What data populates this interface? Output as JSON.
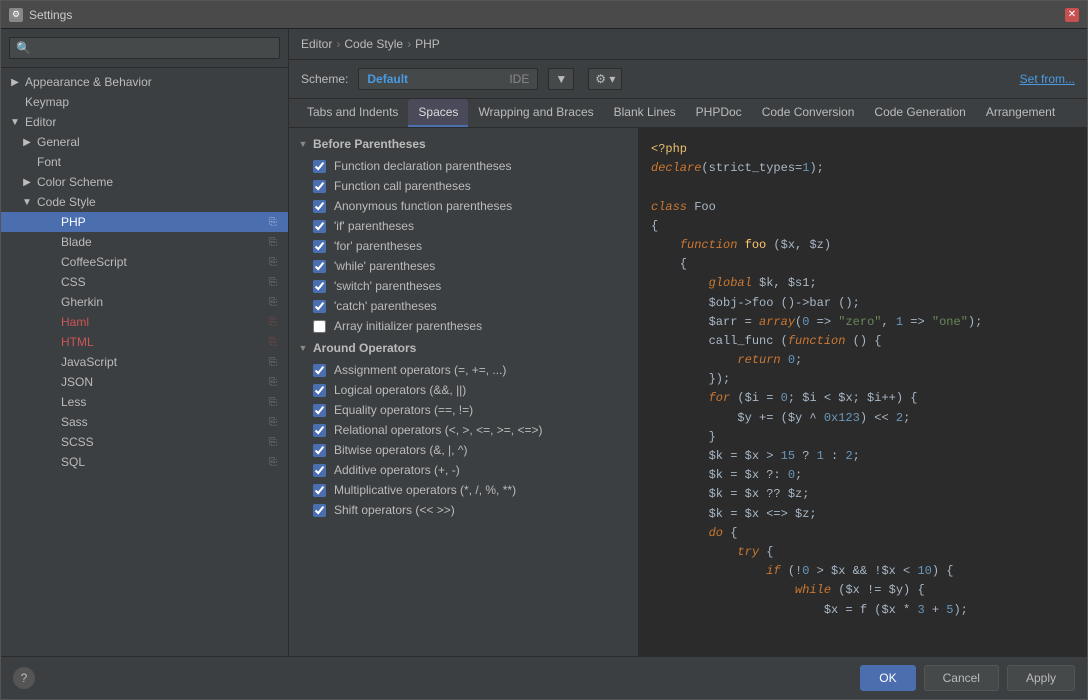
{
  "window": {
    "title": "Settings",
    "icon": "⚙"
  },
  "breadcrumb": {
    "items": [
      "Editor",
      "Code Style",
      "PHP"
    ],
    "separators": [
      "›",
      "›"
    ]
  },
  "scheme": {
    "label": "Scheme:",
    "name": "Default",
    "ide_label": "IDE",
    "set_from": "Set from..."
  },
  "tabs": [
    {
      "label": "Tabs and Indents",
      "active": false
    },
    {
      "label": "Spaces",
      "active": true
    },
    {
      "label": "Wrapping and Braces",
      "active": false
    },
    {
      "label": "Blank Lines",
      "active": false
    },
    {
      "label": "PHPDoc",
      "active": false
    },
    {
      "label": "Code Conversion",
      "active": false
    },
    {
      "label": "Code Generation",
      "active": false
    },
    {
      "label": "Arrangement",
      "active": false
    }
  ],
  "sidebar": {
    "search_placeholder": "🔍",
    "items": [
      {
        "label": "Appearance & Behavior",
        "level": 0,
        "arrow": "closed",
        "selected": false
      },
      {
        "label": "Keymap",
        "level": 0,
        "arrow": "none",
        "selected": false
      },
      {
        "label": "Editor",
        "level": 0,
        "arrow": "open",
        "selected": false
      },
      {
        "label": "General",
        "level": 1,
        "arrow": "closed",
        "selected": false
      },
      {
        "label": "Font",
        "level": 1,
        "arrow": "none",
        "selected": false
      },
      {
        "label": "Color Scheme",
        "level": 1,
        "arrow": "closed",
        "selected": false
      },
      {
        "label": "Code Style",
        "level": 1,
        "arrow": "open",
        "selected": false
      },
      {
        "label": "PHP",
        "level": 2,
        "arrow": "none",
        "selected": true,
        "has_icon": true
      },
      {
        "label": "Blade",
        "level": 2,
        "arrow": "none",
        "selected": false,
        "has_icon": true
      },
      {
        "label": "CoffeeScript",
        "level": 2,
        "arrow": "none",
        "selected": false,
        "has_icon": true
      },
      {
        "label": "CSS",
        "level": 2,
        "arrow": "none",
        "selected": false,
        "has_icon": true
      },
      {
        "label": "Gherkin",
        "level": 2,
        "arrow": "none",
        "selected": false,
        "has_icon": true
      },
      {
        "label": "Haml",
        "level": 2,
        "arrow": "none",
        "selected": false,
        "red": true,
        "has_icon": true
      },
      {
        "label": "HTML",
        "level": 2,
        "arrow": "none",
        "selected": false,
        "red": true,
        "has_icon": true
      },
      {
        "label": "JavaScript",
        "level": 2,
        "arrow": "none",
        "selected": false,
        "has_icon": true
      },
      {
        "label": "JSON",
        "level": 2,
        "arrow": "none",
        "selected": false,
        "has_icon": true
      },
      {
        "label": "Less",
        "level": 2,
        "arrow": "none",
        "selected": false,
        "has_icon": true
      },
      {
        "label": "Sass",
        "level": 2,
        "arrow": "none",
        "selected": false,
        "has_icon": true
      },
      {
        "label": "SCSS",
        "level": 2,
        "arrow": "none",
        "selected": false,
        "has_icon": true
      },
      {
        "label": "SQL",
        "level": 2,
        "arrow": "none",
        "selected": false,
        "has_icon": true
      }
    ]
  },
  "settings_sections": [
    {
      "label": "Before Parentheses",
      "open": true,
      "items": [
        {
          "label": "Function declaration parentheses",
          "checked": true
        },
        {
          "label": "Function call parentheses",
          "checked": true
        },
        {
          "label": "Anonymous function parentheses",
          "checked": true
        },
        {
          "label": "'if' parentheses",
          "checked": true
        },
        {
          "label": "'for' parentheses",
          "checked": true
        },
        {
          "label": "'while' parentheses",
          "checked": true
        },
        {
          "label": "'switch' parentheses",
          "checked": true
        },
        {
          "label": "'catch' parentheses",
          "checked": true
        },
        {
          "label": "Array initializer parentheses",
          "checked": false
        }
      ]
    },
    {
      "label": "Around Operators",
      "open": true,
      "items": [
        {
          "label": "Assignment operators (=, +=, ...)",
          "checked": true
        },
        {
          "label": "Logical operators (&&, ||)",
          "checked": true
        },
        {
          "label": "Equality operators (==, !=)",
          "checked": true
        },
        {
          "label": "Relational operators (<, >, <=, >=, <=>)",
          "checked": true
        },
        {
          "label": "Bitwise operators (&, |, ^)",
          "checked": true
        },
        {
          "label": "Additive operators (+, -)",
          "checked": true
        },
        {
          "label": "Multiplicative operators (*, /, %, **)",
          "checked": true
        },
        {
          "label": "Shift operators (<< >>)",
          "checked": true
        }
      ]
    }
  ],
  "code_preview": [
    {
      "tokens": [
        {
          "text": "<?php",
          "class": "c-tag"
        }
      ]
    },
    {
      "tokens": [
        {
          "text": "declare",
          "class": "c-keyword"
        },
        {
          "text": "(strict_types=",
          "class": "c-default"
        },
        {
          "text": "1",
          "class": "c-number"
        },
        {
          "text": ");",
          "class": "c-default"
        }
      ]
    },
    {
      "tokens": []
    },
    {
      "tokens": [
        {
          "text": "class",
          "class": "c-keyword"
        },
        {
          "text": " Foo",
          "class": "c-default"
        }
      ]
    },
    {
      "tokens": [
        {
          "text": "{",
          "class": "c-default"
        }
      ]
    },
    {
      "tokens": [
        {
          "text": "    ",
          "class": "c-default"
        },
        {
          "text": "function",
          "class": "c-keyword"
        },
        {
          "text": " ",
          "class": "c-default"
        },
        {
          "text": "foo",
          "class": "c-function"
        },
        {
          "text": " ($x, $z)",
          "class": "c-default"
        }
      ]
    },
    {
      "tokens": [
        {
          "text": "    {",
          "class": "c-default"
        }
      ]
    },
    {
      "tokens": [
        {
          "text": "        ",
          "class": "c-default"
        },
        {
          "text": "global",
          "class": "c-keyword"
        },
        {
          "text": " $k, $s1;",
          "class": "c-default"
        }
      ]
    },
    {
      "tokens": [
        {
          "text": "        $obj->foo ()->bar ();",
          "class": "c-default"
        }
      ]
    },
    {
      "tokens": [
        {
          "text": "        $arr = ",
          "class": "c-default"
        },
        {
          "text": "array",
          "class": "c-keyword"
        },
        {
          "text": "(",
          "class": "c-default"
        },
        {
          "text": "0",
          "class": "c-number"
        },
        {
          "text": " => ",
          "class": "c-default"
        },
        {
          "text": "\"zero\"",
          "class": "c-string"
        },
        {
          "text": ", ",
          "class": "c-default"
        },
        {
          "text": "1",
          "class": "c-number"
        },
        {
          "text": " => ",
          "class": "c-default"
        },
        {
          "text": "\"one\"",
          "class": "c-string"
        },
        {
          "text": ");",
          "class": "c-default"
        }
      ]
    },
    {
      "tokens": [
        {
          "text": "        call_func (",
          "class": "c-default"
        },
        {
          "text": "function",
          "class": "c-keyword"
        },
        {
          "text": " () {",
          "class": "c-default"
        }
      ]
    },
    {
      "tokens": [
        {
          "text": "            ",
          "class": "c-default"
        },
        {
          "text": "return",
          "class": "c-keyword"
        },
        {
          "text": " ",
          "class": "c-default"
        },
        {
          "text": "0",
          "class": "c-number"
        },
        {
          "text": ";",
          "class": "c-default"
        }
      ]
    },
    {
      "tokens": [
        {
          "text": "        });",
          "class": "c-default"
        }
      ]
    },
    {
      "tokens": [
        {
          "text": "        ",
          "class": "c-default"
        },
        {
          "text": "for",
          "class": "c-keyword"
        },
        {
          "text": " ($i = ",
          "class": "c-default"
        },
        {
          "text": "0",
          "class": "c-number"
        },
        {
          "text": "; $i < $x; $i++) {",
          "class": "c-default"
        }
      ]
    },
    {
      "tokens": [
        {
          "text": "            $y += ($y ^ ",
          "class": "c-default"
        },
        {
          "text": "0x123",
          "class": "c-number"
        },
        {
          "text": ") << ",
          "class": "c-default"
        },
        {
          "text": "2",
          "class": "c-number"
        },
        {
          "text": ";",
          "class": "c-default"
        }
      ]
    },
    {
      "tokens": [
        {
          "text": "        }",
          "class": "c-default"
        }
      ]
    },
    {
      "tokens": [
        {
          "text": "        $k = $x > ",
          "class": "c-default"
        },
        {
          "text": "15",
          "class": "c-number"
        },
        {
          "text": " ? ",
          "class": "c-default"
        },
        {
          "text": "1",
          "class": "c-number"
        },
        {
          "text": " : ",
          "class": "c-default"
        },
        {
          "text": "2",
          "class": "c-number"
        },
        {
          "text": ";",
          "class": "c-default"
        }
      ]
    },
    {
      "tokens": [
        {
          "text": "        $k = $x ?: ",
          "class": "c-default"
        },
        {
          "text": "0",
          "class": "c-number"
        },
        {
          "text": ";",
          "class": "c-default"
        }
      ]
    },
    {
      "tokens": [
        {
          "text": "        $k = $x ?? $z;",
          "class": "c-default"
        }
      ]
    },
    {
      "tokens": [
        {
          "text": "        $k = $x <=> $z;",
          "class": "c-default"
        }
      ]
    },
    {
      "tokens": [
        {
          "text": "        ",
          "class": "c-default"
        },
        {
          "text": "do",
          "class": "c-keyword"
        },
        {
          "text": " {",
          "class": "c-default"
        }
      ]
    },
    {
      "tokens": [
        {
          "text": "            ",
          "class": "c-default"
        },
        {
          "text": "try",
          "class": "c-keyword"
        },
        {
          "text": " {",
          "class": "c-default"
        }
      ]
    },
    {
      "tokens": [
        {
          "text": "                ",
          "class": "c-default"
        },
        {
          "text": "if",
          "class": "c-keyword"
        },
        {
          "text": " (!",
          "class": "c-default"
        },
        {
          "text": "0",
          "class": "c-number"
        },
        {
          "text": " > $x && !$x < ",
          "class": "c-default"
        },
        {
          "text": "10",
          "class": "c-number"
        },
        {
          "text": ") {",
          "class": "c-default"
        }
      ]
    },
    {
      "tokens": [
        {
          "text": "                    ",
          "class": "c-default"
        },
        {
          "text": "while",
          "class": "c-keyword"
        },
        {
          "text": " ($x != $y) {",
          "class": "c-default"
        }
      ]
    },
    {
      "tokens": [
        {
          "text": "                        $x = f ($x * ",
          "class": "c-default"
        },
        {
          "text": "3",
          "class": "c-number"
        },
        {
          "text": " + ",
          "class": "c-default"
        },
        {
          "text": "5",
          "class": "c-number"
        },
        {
          "text": ");",
          "class": "c-default"
        }
      ]
    }
  ],
  "footer": {
    "help_label": "?",
    "ok_label": "OK",
    "cancel_label": "Cancel",
    "apply_label": "Apply"
  }
}
